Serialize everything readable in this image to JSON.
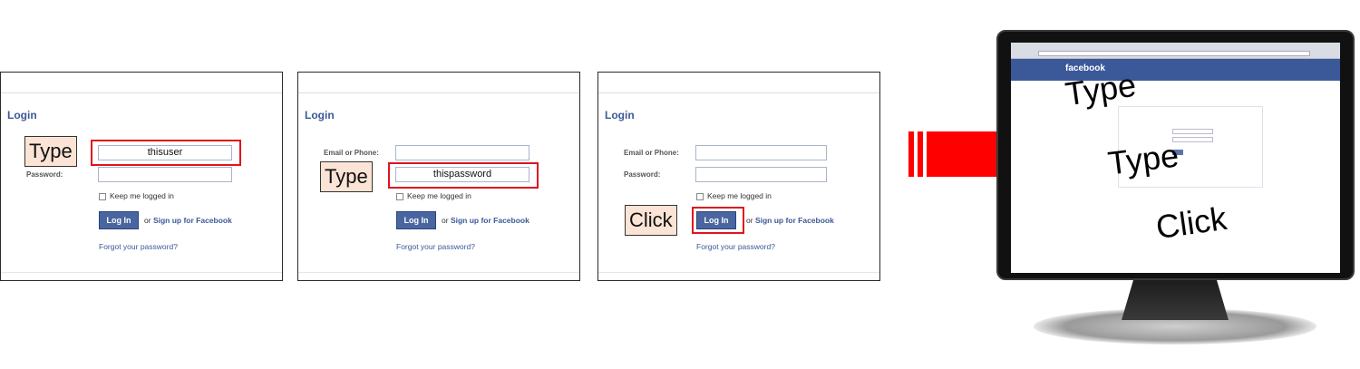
{
  "panels": [
    {
      "title": "Login",
      "email_label": "",
      "password_label": "Password:",
      "keep_label": "Keep me logged in",
      "login_button": "Log In",
      "or_text": "or",
      "signup_link": "Sign up for Facebook",
      "forgot_link": "Forgot your password?",
      "highlight_text": "thisuser",
      "action_tag": "Type"
    },
    {
      "title": "Login",
      "email_label": "Email or Phone:",
      "password_label": "",
      "keep_label": "Keep me logged in",
      "login_button": "Log In",
      "or_text": "or",
      "signup_link": "Sign up for Facebook",
      "forgot_link": "Forgot your password?",
      "highlight_text": "thispassword",
      "action_tag": "Type"
    },
    {
      "title": "Login",
      "email_label": "Email or Phone:",
      "password_label": "Password:",
      "keep_label": "Keep me logged in",
      "login_button": "Log In",
      "or_text": "or",
      "signup_link": "Sign up for Facebook",
      "forgot_link": "Forgot your password?",
      "highlight_text": "",
      "action_tag": "Click"
    }
  ],
  "arrow_color": "#ff0000",
  "monitor": {
    "brand": "facebook",
    "overlay_words": [
      "Type",
      "Type",
      "Click"
    ]
  }
}
